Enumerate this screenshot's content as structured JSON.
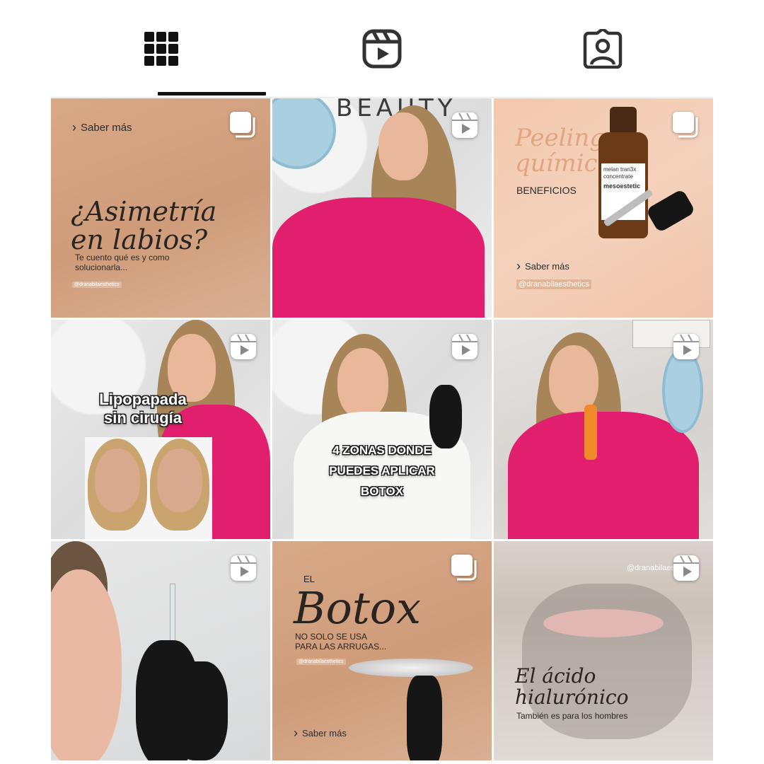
{
  "tabs": [
    {
      "name": "grid-tab",
      "icon": "grid-icon",
      "active": true
    },
    {
      "name": "reels-tab",
      "icon": "reels-icon",
      "active": false
    },
    {
      "name": "tagged-tab",
      "icon": "tagged-icon",
      "active": false
    }
  ],
  "posts": [
    {
      "type": "carousel",
      "link": "Saber más",
      "title": "¿Asimetría en labios?",
      "title_line1": "¿Asimetría",
      "title_line2": "en labios?",
      "subtitle_line1": "Te cuento qué es y como",
      "subtitle_line2": "solucionarla...",
      "handle": "@dranabilaesthetics"
    },
    {
      "type": "reel",
      "wall_text": "BEAUTY"
    },
    {
      "type": "carousel",
      "title_line1": "Peeling",
      "title_line2": "químico",
      "section": "BENEFICIOS",
      "bottle_line1": "melan tran3x",
      "bottle_line2": "concentrate",
      "bottle_brand": "mesoestetic",
      "link": "Saber más",
      "handle": "@dranabilaesthetics"
    },
    {
      "type": "reel",
      "overlay_line1": "Lipopapada",
      "overlay_line2": "sin cirugía"
    },
    {
      "type": "reel",
      "overlay_line1": "4 ZONAS DONDE",
      "overlay_line2": "PUEDES APLICAR",
      "overlay_line3": "BOTOX"
    },
    {
      "type": "reel"
    },
    {
      "type": "reel"
    },
    {
      "type": "carousel",
      "eyebrow": "EL",
      "title": "Botox",
      "subtitle_line1": "NO SOLO SE USA",
      "subtitle_line2": "PARA LAS ARRUGAS...",
      "handle": "@dranabilaesthetics",
      "link": "Saber más"
    },
    {
      "type": "reel",
      "handle": "@dranabilaes",
      "title_line1": "El ácido",
      "title_line2": "hialurónico",
      "subtitle": "También es para los hombres"
    }
  ],
  "colors": {
    "accent": "#111111",
    "tan": "#d4a584",
    "peach": "#f3cbb3",
    "pink": "#e21f6e"
  }
}
